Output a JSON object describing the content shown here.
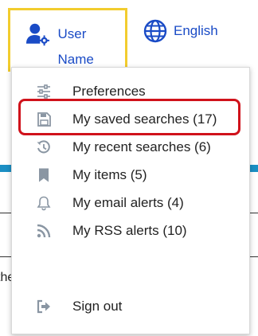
{
  "header": {
    "user_label": "User Name",
    "user_icon": "user-gear-icon",
    "language_label": "English",
    "language_icon": "globe-icon"
  },
  "menu": {
    "items": [
      {
        "label": "Preferences",
        "icon": "sliders-icon"
      },
      {
        "label": "My saved searches (17)",
        "icon": "floppy-disk-icon"
      },
      {
        "label": "My recent searches (6)",
        "icon": "history-icon"
      },
      {
        "label": "My items (5)",
        "icon": "bookmark-icon"
      },
      {
        "label": "My email alerts (4)",
        "icon": "bell-icon"
      },
      {
        "label": "My RSS alerts (10)",
        "icon": "rss-icon"
      },
      {
        "label": "Sign out",
        "icon": "sign-out-icon"
      }
    ]
  },
  "background": {
    "partial_text": "the"
  },
  "colors": {
    "accent_blue": "#1a4bc6",
    "focus_yellow": "#f2cc2e",
    "highlight_red": "#d0121b",
    "teal_bar": "#1b8fc4",
    "icon_gray": "#8a96a3"
  }
}
